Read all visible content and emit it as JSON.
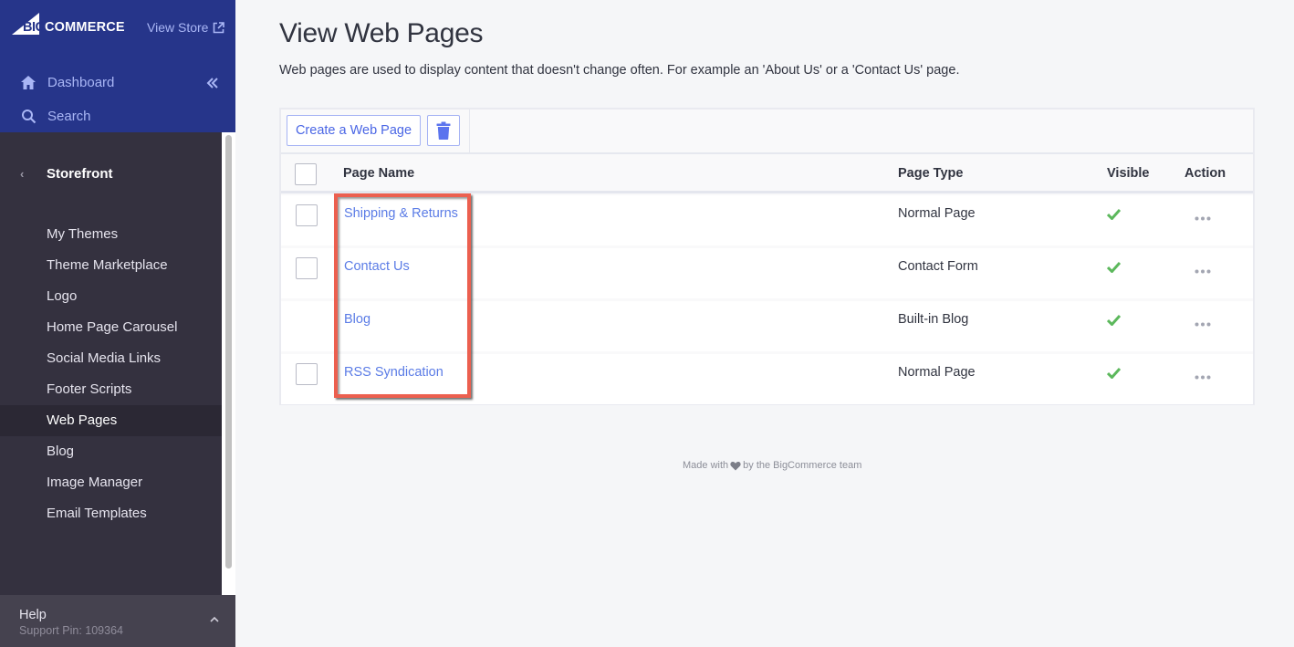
{
  "sidebar": {
    "logo": {
      "big": "BIG",
      "commerce": "COMMERCE"
    },
    "view_store": "View Store",
    "dashboard": "Dashboard",
    "search": "Search",
    "section": "Storefront",
    "items": [
      {
        "label": "My Themes"
      },
      {
        "label": "Theme Marketplace"
      },
      {
        "label": "Logo"
      },
      {
        "label": "Home Page Carousel"
      },
      {
        "label": "Social Media Links"
      },
      {
        "label": "Footer Scripts"
      },
      {
        "label": "Web Pages",
        "active": true
      },
      {
        "label": "Blog"
      },
      {
        "label": "Image Manager"
      },
      {
        "label": "Email Templates"
      }
    ],
    "help": {
      "title": "Help",
      "support_pin": "Support Pin: 109364"
    }
  },
  "main": {
    "title": "View Web Pages",
    "description": "Web pages are used to display content that doesn't change often. For example an 'About Us' or a 'Contact Us' page.",
    "toolbar": {
      "create_label": "Create a Web Page",
      "delete_icon": "trash-icon"
    },
    "table": {
      "headers": {
        "name": "Page Name",
        "type": "Page Type",
        "visible": "Visible",
        "action": "Action"
      },
      "rows": [
        {
          "name": "Shipping & Returns",
          "type": "Normal Page",
          "visible": true,
          "has_checkbox": true
        },
        {
          "name": "Contact Us",
          "type": "Contact Form",
          "visible": true,
          "has_checkbox": true
        },
        {
          "name": "Blog",
          "type": "Built-in Blog",
          "visible": true,
          "has_checkbox": false
        },
        {
          "name": "RSS Syndication",
          "type": "Normal Page",
          "visible": true,
          "has_checkbox": true
        }
      ]
    },
    "footer": {
      "before": "Made with",
      "after": "by the BigCommerce team"
    }
  },
  "colors": {
    "sidebar_top": "#26358a",
    "sidebar": "#34313f",
    "link": "#5b7ce6",
    "highlight": "#ec5f4f",
    "check": "#5cb85c"
  }
}
